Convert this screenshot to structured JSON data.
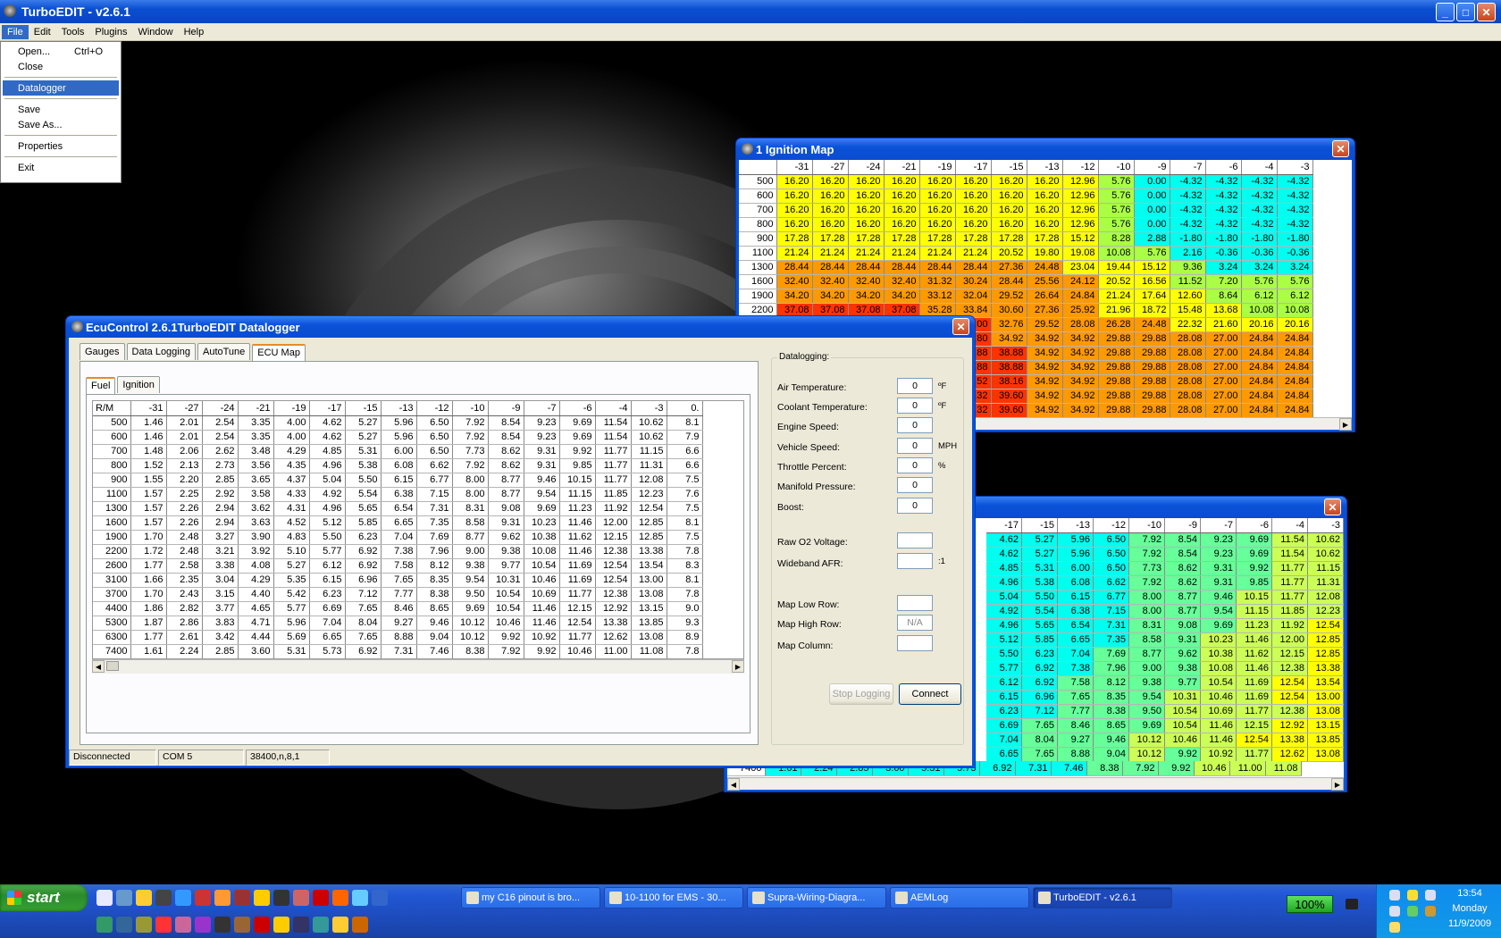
{
  "app": {
    "title": "TurboEDIT - v2.6.1",
    "menus": [
      "File",
      "Edit",
      "Tools",
      "Plugins",
      "Window",
      "Help"
    ]
  },
  "file_menu": {
    "open": "Open...",
    "open_shortcut": "Ctrl+O",
    "close": "Close",
    "datalogger": "Datalogger",
    "save": "Save",
    "save_as": "Save As...",
    "properties": "Properties",
    "exit": "Exit"
  },
  "colors": {
    "accent": "#0054e3",
    "ign_yellow": "#ffff00",
    "ign_green": "#aaff44",
    "ign_cyan": "#00ffee",
    "ign_orange": "#ff9900",
    "ign_red": "#ff3300"
  },
  "ignition": {
    "title": "1 Ignition Map",
    "cols": [
      "-31",
      "-27",
      "-24",
      "-21",
      "-19",
      "-17",
      "-15",
      "-13",
      "-12",
      "-10",
      "-9",
      "-7",
      "-6",
      "-4",
      "-3"
    ],
    "rows": [
      {
        "rpm": "500",
        "v": [
          "16.20",
          "16.20",
          "16.20",
          "16.20",
          "16.20",
          "16.20",
          "16.20",
          "16.20",
          "12.96",
          "5.76",
          "0.00",
          "-4.32",
          "-4.32",
          "-4.32",
          "-4.32"
        ]
      },
      {
        "rpm": "600",
        "v": [
          "16.20",
          "16.20",
          "16.20",
          "16.20",
          "16.20",
          "16.20",
          "16.20",
          "16.20",
          "12.96",
          "5.76",
          "0.00",
          "-4.32",
          "-4.32",
          "-4.32",
          "-4.32"
        ]
      },
      {
        "rpm": "700",
        "v": [
          "16.20",
          "16.20",
          "16.20",
          "16.20",
          "16.20",
          "16.20",
          "16.20",
          "16.20",
          "12.96",
          "5.76",
          "0.00",
          "-4.32",
          "-4.32",
          "-4.32",
          "-4.32"
        ]
      },
      {
        "rpm": "800",
        "v": [
          "16.20",
          "16.20",
          "16.20",
          "16.20",
          "16.20",
          "16.20",
          "16.20",
          "16.20",
          "12.96",
          "5.76",
          "0.00",
          "-4.32",
          "-4.32",
          "-4.32",
          "-4.32"
        ]
      },
      {
        "rpm": "900",
        "v": [
          "17.28",
          "17.28",
          "17.28",
          "17.28",
          "17.28",
          "17.28",
          "17.28",
          "17.28",
          "15.12",
          "8.28",
          "2.88",
          "-1.80",
          "-1.80",
          "-1.80",
          "-1.80"
        ]
      },
      {
        "rpm": "1100",
        "v": [
          "21.24",
          "21.24",
          "21.24",
          "21.24",
          "21.24",
          "21.24",
          "20.52",
          "19.80",
          "19.08",
          "10.08",
          "5.76",
          "2.16",
          "-0.36",
          "-0.36",
          "-0.36"
        ]
      },
      {
        "rpm": "1300",
        "v": [
          "28.44",
          "28.44",
          "28.44",
          "28.44",
          "28.44",
          "28.44",
          "27.36",
          "24.48",
          "23.04",
          "19.44",
          "15.12",
          "9.36",
          "3.24",
          "3.24",
          "3.24"
        ]
      },
      {
        "rpm": "1600",
        "v": [
          "32.40",
          "32.40",
          "32.40",
          "32.40",
          "31.32",
          "30.24",
          "28.44",
          "25.56",
          "24.12",
          "20.52",
          "16.56",
          "11.52",
          "7.20",
          "5.76",
          "5.76"
        ]
      },
      {
        "rpm": "1900",
        "v": [
          "34.20",
          "34.20",
          "34.20",
          "34.20",
          "33.12",
          "32.04",
          "29.52",
          "26.64",
          "24.84",
          "21.24",
          "17.64",
          "12.60",
          "8.64",
          "6.12",
          "6.12"
        ]
      },
      {
        "rpm": "2200",
        "v": [
          "37.08",
          "37.08",
          "37.08",
          "37.08",
          "35.28",
          "33.84",
          "30.60",
          "27.36",
          "25.92",
          "21.96",
          "18.72",
          "15.48",
          "13.68",
          "10.08",
          "10.08"
        ]
      },
      {
        "rpm": "",
        "v": [
          "",
          "",
          "",
          "",
          "",
          "36.00",
          "32.76",
          "29.52",
          "28.08",
          "26.28",
          "24.48",
          "22.32",
          "21.60",
          "20.16",
          "20.16"
        ]
      },
      {
        "rpm": "",
        "v": [
          "",
          "",
          "",
          "",
          "",
          "37.80",
          "34.92",
          "34.92",
          "34.92",
          "29.88",
          "29.88",
          "28.08",
          "27.00",
          "24.84",
          "24.84"
        ]
      },
      {
        "rpm": "",
        "v": [
          "",
          "",
          "",
          "",
          "",
          "38.88",
          "38.88",
          "34.92",
          "34.92",
          "29.88",
          "29.88",
          "28.08",
          "27.00",
          "24.84",
          "24.84"
        ]
      },
      {
        "rpm": "",
        "v": [
          "",
          "",
          "",
          "",
          "",
          "38.88",
          "38.88",
          "34.92",
          "34.92",
          "29.88",
          "29.88",
          "28.08",
          "27.00",
          "24.84",
          "24.84"
        ]
      },
      {
        "rpm": "",
        "v": [
          "",
          "",
          "",
          "",
          "",
          "38.52",
          "38.16",
          "34.92",
          "34.92",
          "29.88",
          "29.88",
          "28.08",
          "27.00",
          "24.84",
          "24.84"
        ]
      },
      {
        "rpm": "",
        "v": [
          "",
          "",
          "",
          "",
          "",
          "40.32",
          "39.60",
          "34.92",
          "34.92",
          "29.88",
          "29.88",
          "28.08",
          "27.00",
          "24.84",
          "24.84"
        ]
      },
      {
        "rpm": "",
        "v": [
          "",
          "",
          "",
          "",
          "",
          "40.32",
          "39.60",
          "34.92",
          "34.92",
          "29.88",
          "29.88",
          "28.08",
          "27.00",
          "24.84",
          "24.84"
        ]
      }
    ]
  },
  "fuel2": {
    "cols": [
      "-17",
      "-15",
      "-13",
      "-12",
      "-10",
      "-9",
      "-7",
      "-6",
      "-4",
      "-3"
    ],
    "rows": [
      [
        "4.62",
        "5.27",
        "5.96",
        "6.50",
        "7.92",
        "8.54",
        "9.23",
        "9.69",
        "11.54",
        "10.62"
      ],
      [
        "4.62",
        "5.27",
        "5.96",
        "6.50",
        "7.92",
        "8.54",
        "9.23",
        "9.69",
        "11.54",
        "10.62"
      ],
      [
        "4.85",
        "5.31",
        "6.00",
        "6.50",
        "7.73",
        "8.62",
        "9.31",
        "9.92",
        "11.77",
        "11.15"
      ],
      [
        "4.96",
        "5.38",
        "6.08",
        "6.62",
        "7.92",
        "8.62",
        "9.31",
        "9.85",
        "11.77",
        "11.31"
      ],
      [
        "5.04",
        "5.50",
        "6.15",
        "6.77",
        "8.00",
        "8.77",
        "9.46",
        "10.15",
        "11.77",
        "12.08"
      ],
      [
        "4.92",
        "5.54",
        "6.38",
        "7.15",
        "8.00",
        "8.77",
        "9.54",
        "11.15",
        "11.85",
        "12.23"
      ],
      [
        "4.96",
        "5.65",
        "6.54",
        "7.31",
        "8.31",
        "9.08",
        "9.69",
        "11.23",
        "11.92",
        "12.54"
      ],
      [
        "5.12",
        "5.85",
        "6.65",
        "7.35",
        "8.58",
        "9.31",
        "10.23",
        "11.46",
        "12.00",
        "12.85"
      ],
      [
        "5.50",
        "6.23",
        "7.04",
        "7.69",
        "8.77",
        "9.62",
        "10.38",
        "11.62",
        "12.15",
        "12.85"
      ],
      [
        "5.77",
        "6.92",
        "7.38",
        "7.96",
        "9.00",
        "9.38",
        "10.08",
        "11.46",
        "12.38",
        "13.38"
      ],
      [
        "6.12",
        "6.92",
        "7.58",
        "8.12",
        "9.38",
        "9.77",
        "10.54",
        "11.69",
        "12.54",
        "13.54"
      ],
      [
        "6.15",
        "6.96",
        "7.65",
        "8.35",
        "9.54",
        "10.31",
        "10.46",
        "11.69",
        "12.54",
        "13.00"
      ],
      [
        "6.23",
        "7.12",
        "7.77",
        "8.38",
        "9.50",
        "10.54",
        "10.69",
        "11.77",
        "12.38",
        "13.08"
      ],
      [
        "6.69",
        "7.65",
        "8.46",
        "8.65",
        "9.69",
        "10.54",
        "11.46",
        "12.15",
        "12.92",
        "13.15"
      ],
      [
        "7.04",
        "8.04",
        "9.27",
        "9.46",
        "10.12",
        "10.46",
        "11.46",
        "12.54",
        "13.38",
        "13.85"
      ],
      [
        "6.65",
        "7.65",
        "8.88",
        "9.04",
        "10.12",
        "9.92",
        "10.92",
        "11.77",
        "12.62",
        "13.08"
      ]
    ],
    "last_row": {
      "rpm": "7400",
      "v": [
        "1.61",
        "2.24",
        "2.85",
        "3.60",
        "5.31",
        "5.73",
        "6.92",
        "7.31",
        "7.46",
        "8.38",
        "7.92",
        "9.92",
        "10.46",
        "11.00",
        "11.08"
      ]
    }
  },
  "logger": {
    "title": "EcuControl 2.6.1TurboEDIT Datalogger",
    "tabs": [
      "Gauges",
      "Data Logging",
      "AutoTune",
      "ECU Map"
    ],
    "subtabs": [
      "Fuel",
      "Ignition"
    ],
    "corner": "R/M",
    "cols": [
      "-31",
      "-27",
      "-24",
      "-21",
      "-19",
      "-17",
      "-15",
      "-13",
      "-12",
      "-10",
      "-9",
      "-7",
      "-6",
      "-4",
      "-3",
      "0."
    ],
    "rows": [
      {
        "rpm": "500",
        "v": [
          "1.46",
          "2.01",
          "2.54",
          "3.35",
          "4.00",
          "4.62",
          "5.27",
          "5.96",
          "6.50",
          "7.92",
          "8.54",
          "9.23",
          "9.69",
          "11.54",
          "10.62",
          "8.1"
        ]
      },
      {
        "rpm": "600",
        "v": [
          "1.46",
          "2.01",
          "2.54",
          "3.35",
          "4.00",
          "4.62",
          "5.27",
          "5.96",
          "6.50",
          "7.92",
          "8.54",
          "9.23",
          "9.69",
          "11.54",
          "10.62",
          "7.9"
        ]
      },
      {
        "rpm": "700",
        "v": [
          "1.48",
          "2.06",
          "2.62",
          "3.48",
          "4.29",
          "4.85",
          "5.31",
          "6.00",
          "6.50",
          "7.73",
          "8.62",
          "9.31",
          "9.92",
          "11.77",
          "11.15",
          "6.6"
        ]
      },
      {
        "rpm": "800",
        "v": [
          "1.52",
          "2.13",
          "2.73",
          "3.56",
          "4.35",
          "4.96",
          "5.38",
          "6.08",
          "6.62",
          "7.92",
          "8.62",
          "9.31",
          "9.85",
          "11.77",
          "11.31",
          "6.6"
        ]
      },
      {
        "rpm": "900",
        "v": [
          "1.55",
          "2.20",
          "2.85",
          "3.65",
          "4.37",
          "5.04",
          "5.50",
          "6.15",
          "6.77",
          "8.00",
          "8.77",
          "9.46",
          "10.15",
          "11.77",
          "12.08",
          "7.5"
        ]
      },
      {
        "rpm": "1100",
        "v": [
          "1.57",
          "2.25",
          "2.92",
          "3.58",
          "4.33",
          "4.92",
          "5.54",
          "6.38",
          "7.15",
          "8.00",
          "8.77",
          "9.54",
          "11.15",
          "11.85",
          "12.23",
          "7.6"
        ]
      },
      {
        "rpm": "1300",
        "v": [
          "1.57",
          "2.26",
          "2.94",
          "3.62",
          "4.31",
          "4.96",
          "5.65",
          "6.54",
          "7.31",
          "8.31",
          "9.08",
          "9.69",
          "11.23",
          "11.92",
          "12.54",
          "7.5"
        ]
      },
      {
        "rpm": "1600",
        "v": [
          "1.57",
          "2.26",
          "2.94",
          "3.63",
          "4.52",
          "5.12",
          "5.85",
          "6.65",
          "7.35",
          "8.58",
          "9.31",
          "10.23",
          "11.46",
          "12.00",
          "12.85",
          "8.1"
        ]
      },
      {
        "rpm": "1900",
        "v": [
          "1.70",
          "2.48",
          "3.27",
          "3.90",
          "4.83",
          "5.50",
          "6.23",
          "7.04",
          "7.69",
          "8.77",
          "9.62",
          "10.38",
          "11.62",
          "12.15",
          "12.85",
          "7.5"
        ]
      },
      {
        "rpm": "2200",
        "v": [
          "1.72",
          "2.48",
          "3.21",
          "3.92",
          "5.10",
          "5.77",
          "6.92",
          "7.38",
          "7.96",
          "9.00",
          "9.38",
          "10.08",
          "11.46",
          "12.38",
          "13.38",
          "7.8"
        ]
      },
      {
        "rpm": "2600",
        "v": [
          "1.77",
          "2.58",
          "3.38",
          "4.08",
          "5.27",
          "6.12",
          "6.92",
          "7.58",
          "8.12",
          "9.38",
          "9.77",
          "10.54",
          "11.69",
          "12.54",
          "13.54",
          "8.3"
        ]
      },
      {
        "rpm": "3100",
        "v": [
          "1.66",
          "2.35",
          "3.04",
          "4.29",
          "5.35",
          "6.15",
          "6.96",
          "7.65",
          "8.35",
          "9.54",
          "10.31",
          "10.46",
          "11.69",
          "12.54",
          "13.00",
          "8.1"
        ]
      },
      {
        "rpm": "3700",
        "v": [
          "1.70",
          "2.43",
          "3.15",
          "4.40",
          "5.42",
          "6.23",
          "7.12",
          "7.77",
          "8.38",
          "9.50",
          "10.54",
          "10.69",
          "11.77",
          "12.38",
          "13.08",
          "7.8"
        ]
      },
      {
        "rpm": "4400",
        "v": [
          "1.86",
          "2.82",
          "3.77",
          "4.65",
          "5.77",
          "6.69",
          "7.65",
          "8.46",
          "8.65",
          "9.69",
          "10.54",
          "11.46",
          "12.15",
          "12.92",
          "13.15",
          "9.0"
        ]
      },
      {
        "rpm": "5300",
        "v": [
          "1.87",
          "2.86",
          "3.83",
          "4.71",
          "5.96",
          "7.04",
          "8.04",
          "9.27",
          "9.46",
          "10.12",
          "10.46",
          "11.46",
          "12.54",
          "13.38",
          "13.85",
          "9.3"
        ]
      },
      {
        "rpm": "6300",
        "v": [
          "1.77",
          "2.61",
          "3.42",
          "4.44",
          "5.69",
          "6.65",
          "7.65",
          "8.88",
          "9.04",
          "10.12",
          "9.92",
          "10.92",
          "11.77",
          "12.62",
          "13.08",
          "8.9"
        ]
      },
      {
        "rpm": "7400",
        "v": [
          "1.61",
          "2.24",
          "2.85",
          "3.60",
          "5.31",
          "5.73",
          "6.92",
          "7.31",
          "7.46",
          "8.38",
          "7.92",
          "9.92",
          "10.46",
          "11.00",
          "11.08",
          "7.8"
        ]
      }
    ],
    "datalogging_label": "Datalogging:",
    "fields": [
      {
        "label": "Air Temperature:",
        "value": "0",
        "unit": "ºF"
      },
      {
        "label": "Coolant Temperature:",
        "value": "0",
        "unit": "ºF"
      },
      {
        "label": "Engine Speed:",
        "value": "0",
        "unit": ""
      },
      {
        "label": "Vehicle Speed:",
        "value": "0",
        "unit": "MPH"
      },
      {
        "label": "Throttle Percent:",
        "value": "0",
        "unit": "%"
      },
      {
        "label": "Manifold Pressure:",
        "value": "0",
        "unit": ""
      },
      {
        "label": "Boost:",
        "value": "0",
        "unit": ""
      }
    ],
    "raw_o2": {
      "label": "Raw O2 Voltage:",
      "value": ""
    },
    "wideband": {
      "label": "Wideband AFR:",
      "value": "",
      "unit": ":1"
    },
    "map_low": {
      "label": "Map Low Row:",
      "value": ""
    },
    "map_high": {
      "label": "Map High Row:",
      "value": "N/A"
    },
    "map_col": {
      "label": "Map Column:",
      "value": ""
    },
    "stop_label": "Stop Logging",
    "connect_label": "Connect",
    "status": [
      "Disconnected",
      "COM 5",
      "38400,n,8,1"
    ]
  },
  "taskbar": {
    "start": "start",
    "tasks": [
      "my C16 pinout is bro...",
      "10-1100 for EMS - 30...",
      "Supra-Wiring-Diagra...",
      "AEMLog",
      "TurboEDIT - v2.6.1"
    ],
    "battery": "100%",
    "time": "13:54",
    "day": "Monday",
    "date": "11/9/2009"
  }
}
